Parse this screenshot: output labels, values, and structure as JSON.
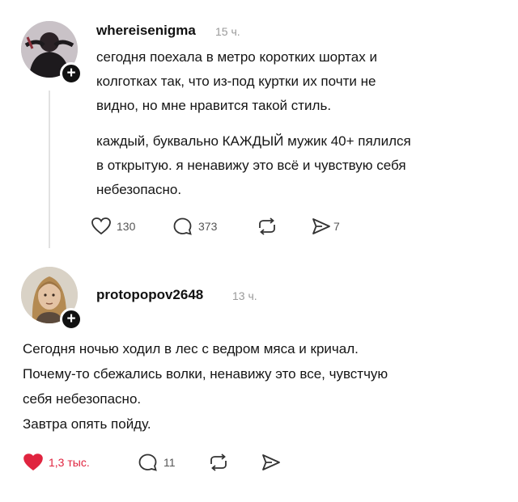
{
  "posts": [
    {
      "username": "whereisenigma",
      "time": "15 ч.",
      "paragraphs": [
        [
          "сегодня поехала в метро коротких шортах и",
          "колготках так, что из-под куртки их почти не",
          "видно, но мне нравится такой стиль."
        ],
        [
          "каждый, буквально КАЖДЫЙ мужик 40+ пялился",
          "в открытую. я ненавижу это всё и чувствую себя",
          "небезопасно."
        ]
      ],
      "likes": "130",
      "comments": "373",
      "shares": "7",
      "liked": false
    },
    {
      "username": "protopopov2648",
      "time": "13 ч.",
      "paragraphs": [
        [
          "Сегодня ночью ходил в лес с ведром мяса и кричал.",
          "Почему-то сбежались волки, ненавижу это все, чувстчую",
          "себя небезопасно."
        ],
        [
          "Завтра опять пойду."
        ]
      ],
      "likes": "1,3 тыс.",
      "comments": "11",
      "liked": true
    }
  ],
  "colors": {
    "like_active": "#e0243f",
    "muted": "#9a9a9a"
  },
  "icons": [
    "heart-icon",
    "comment-icon",
    "repost-icon",
    "send-icon",
    "plus-icon"
  ]
}
